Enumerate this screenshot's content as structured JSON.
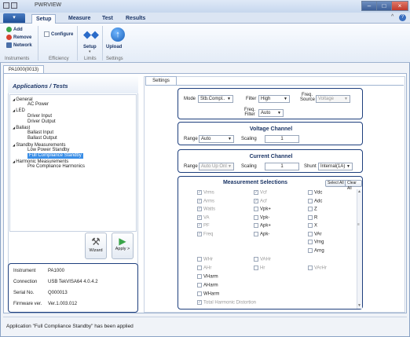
{
  "window": {
    "title": "PWRVIEW"
  },
  "ribbon": {
    "file_label": "",
    "tabs": [
      "Setup",
      "Measure",
      "Test",
      "Results"
    ],
    "groups": {
      "instruments": {
        "label": "Instruments",
        "add": "Add",
        "remove": "Remove",
        "network": "Network"
      },
      "efficiency": {
        "label": "Efficiency",
        "configure": "Configure"
      },
      "limits": {
        "label": "Limits",
        "setup": "Setup"
      },
      "settings": {
        "label": "Settings",
        "upload": "Upload"
      }
    }
  },
  "doc_tab": "PA1000(0013)",
  "applications": {
    "header": "Applications / Tests",
    "tree": [
      {
        "label": "General",
        "level": 0,
        "expander": "◢"
      },
      {
        "label": "AC Power",
        "level": 1
      },
      {
        "label": "LED",
        "level": 0,
        "expander": "◢"
      },
      {
        "label": "Driver Input",
        "level": 1
      },
      {
        "label": "Driver Output",
        "level": 1
      },
      {
        "label": "Ballast",
        "level": 0,
        "expander": "◢"
      },
      {
        "label": "Ballast Input",
        "level": 1
      },
      {
        "label": "Ballast Output",
        "level": 1
      },
      {
        "label": "Standby Measurements",
        "level": 0,
        "expander": "◢"
      },
      {
        "label": "Low Power Standby",
        "level": 1
      },
      {
        "label": "Full Compliance Standby",
        "level": 1,
        "selected": true
      },
      {
        "label": "Harmonic Measurements",
        "level": 0,
        "expander": "◢"
      },
      {
        "label": "Pre Compliance Harmonics",
        "level": 1
      }
    ],
    "wizard_label": "Wizard",
    "apply_label": "Apply >"
  },
  "instrument_info": {
    "instrument_label": "Instrument",
    "instrument_value": "PA1000",
    "connection_label": "Connection",
    "connection_value": "USB TekVISA64 4.0.4.2",
    "serial_label": "Serial No.",
    "serial_value": "Q000013",
    "firmware_label": "Firmware ver.",
    "firmware_value": "Ver.1.003.012"
  },
  "settings": {
    "tab_label": "Settings",
    "mode_label": "Mode",
    "mode_value": "Stb.Compl..",
    "filter_label": "Filter",
    "filter_value": "High",
    "freq_source_label": "Freq. Source",
    "freq_source_value": "Voltage",
    "freq_filter_label": "Freq. Filter",
    "freq_filter_value": "Auto",
    "voltage_title": "Voltage Channel",
    "v_range_label": "Range",
    "v_range_value": "Auto",
    "v_scaling_label": "Scaling",
    "v_scaling_value": "1",
    "current_title": "Current Channel",
    "c_range_label": "Range",
    "c_range_value": "Auto Up Onl",
    "c_scaling_label": "Scaling",
    "c_scaling_value": "1",
    "shunt_label": "Shunt",
    "shunt_value": "Internal(1A)"
  },
  "measurements": {
    "title": "Measurement Selections",
    "select_all": "Select All",
    "clear_all": "Clear All",
    "col1": [
      {
        "label": "Vrms",
        "checked": true,
        "disabled": true
      },
      {
        "label": "Arms",
        "checked": true,
        "disabled": true
      },
      {
        "label": "Watts",
        "checked": true,
        "disabled": true
      },
      {
        "label": "VA",
        "checked": true,
        "disabled": true
      },
      {
        "label": "PF",
        "checked": true,
        "disabled": true
      },
      {
        "label": "Freq",
        "checked": true,
        "disabled": true
      }
    ],
    "col2": [
      {
        "label": "Vcf",
        "checked": true,
        "disabled": true
      },
      {
        "label": "Acf",
        "checked": true,
        "disabled": true
      },
      {
        "label": "Vpk+",
        "checked": false
      },
      {
        "label": "Vpk-",
        "checked": false
      },
      {
        "label": "Apk+",
        "checked": false
      },
      {
        "label": "Apk-",
        "checked": false
      }
    ],
    "col3": [
      {
        "label": "Vdc",
        "checked": false
      },
      {
        "label": "Adc",
        "checked": false
      },
      {
        "label": "Z",
        "checked": false
      },
      {
        "label": "R",
        "checked": false
      },
      {
        "label": "X",
        "checked": false
      },
      {
        "label": "VAr",
        "checked": false
      },
      {
        "label": "Vrng",
        "checked": false
      },
      {
        "label": "Arng",
        "checked": false
      }
    ],
    "lower": [
      {
        "label": "WHr",
        "disabled": true
      },
      {
        "label": "VAHr",
        "disabled": true
      },
      {
        "label": "AHr",
        "disabled": true
      },
      {
        "label": "Hr",
        "disabled": true
      },
      {
        "label": "VArHr",
        "disabled": true
      },
      {
        "label": "VHarm"
      },
      {
        "label": "AHarm"
      },
      {
        "label": "WHarm"
      },
      {
        "label": "Total Harmonic Distortion",
        "checked": true,
        "disabled": true
      }
    ]
  },
  "status_bar": "Application \"Full Compliance Standby\" has been applied"
}
